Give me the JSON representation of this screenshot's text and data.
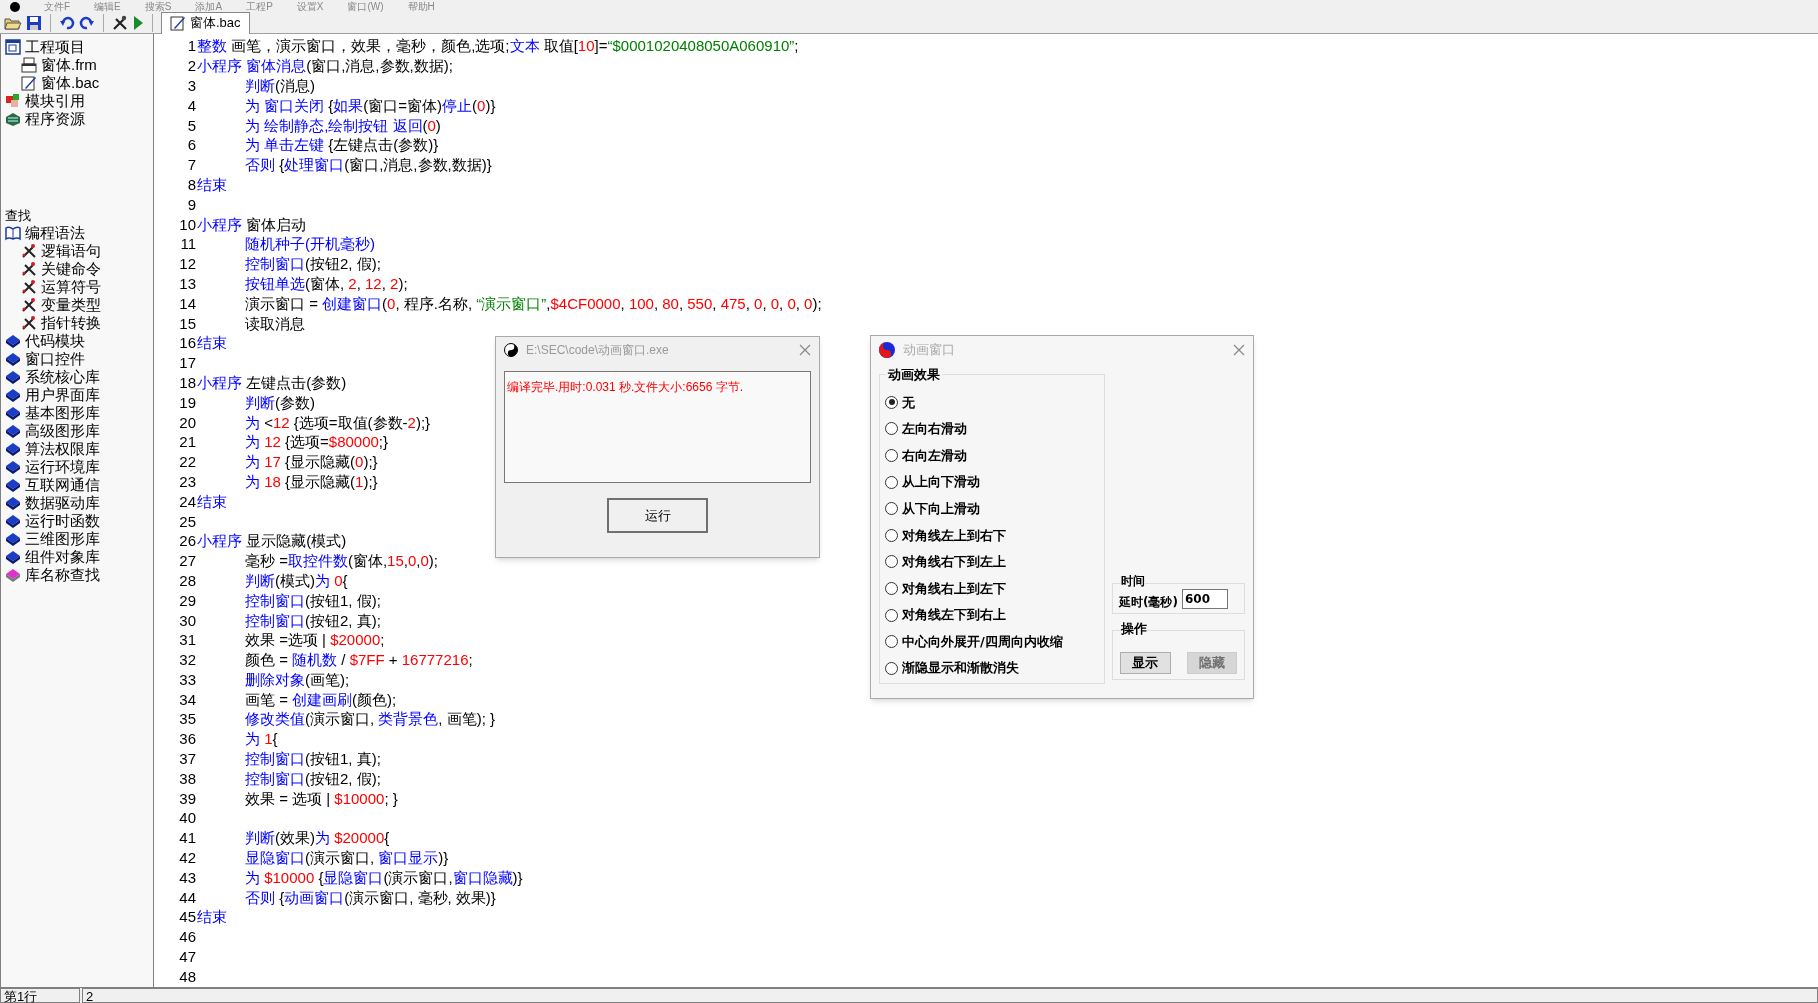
{
  "menu": [
    "文件F",
    "编辑E",
    "搜索S",
    "添加A",
    "工程P",
    "设置X",
    "窗口(W)",
    "帮助H"
  ],
  "toolbar": {
    "tab": {
      "label": "窗体.bac",
      "selected": true
    }
  },
  "sidebar": {
    "project": [
      {
        "label": "工程项目",
        "kind": "project",
        "children": [
          {
            "label": "窗体.frm",
            "kind": "form"
          },
          {
            "label": "窗体.bac",
            "kind": "code"
          }
        ]
      },
      {
        "label": "模块引用",
        "kind": "module"
      },
      {
        "label": "程序资源",
        "kind": "resource"
      }
    ],
    "search_label": "查找",
    "library": [
      {
        "label": "编程语法",
        "kind": "syntax",
        "children": [
          {
            "label": "逻辑语句",
            "kind": "tool"
          },
          {
            "label": "关键命令",
            "kind": "tool"
          },
          {
            "label": "运算符号",
            "kind": "tool"
          },
          {
            "label": "变量类型",
            "kind": "tool"
          },
          {
            "label": "指针转换",
            "kind": "tool"
          }
        ]
      },
      {
        "label": "代码模块",
        "kind": "book"
      },
      {
        "label": "窗口控件",
        "kind": "book"
      },
      {
        "label": "系统核心库",
        "kind": "book"
      },
      {
        "label": "用户界面库",
        "kind": "book"
      },
      {
        "label": "基本图形库",
        "kind": "book"
      },
      {
        "label": "高级图形库",
        "kind": "book"
      },
      {
        "label": "算法权限库",
        "kind": "book"
      },
      {
        "label": "运行环境库",
        "kind": "book"
      },
      {
        "label": "互联网通信",
        "kind": "book"
      },
      {
        "label": "数据驱动库",
        "kind": "book"
      },
      {
        "label": "运行时函数",
        "kind": "book"
      },
      {
        "label": "三维图形库",
        "kind": "book"
      },
      {
        "label": "组件对象库",
        "kind": "book"
      },
      {
        "label": "库名称查找",
        "kind": "search-book"
      }
    ]
  },
  "editor": {
    "lines": [
      {
        "number": "1",
        "indented": false,
        "segments": [
          {
            "kind": "kw",
            "text": "整数"
          },
          {
            "kind": "p",
            "text": " 画笔，演示窗口，效果，毫秒，颜色,选项;"
          },
          {
            "kind": "kw",
            "text": "文本"
          },
          {
            "kind": "p",
            "text": " 取值["
          },
          {
            "kind": "num",
            "text": "10"
          },
          {
            "kind": "p",
            "text": "]="
          },
          {
            "kind": "str",
            "text": "“$0001020408050A060910”"
          },
          {
            "kind": "p",
            "text": ";"
          }
        ]
      },
      {
        "number": "2",
        "indented": false,
        "segments": [
          {
            "kind": "kw",
            "text": "小程序 窗体消息"
          },
          {
            "kind": "p",
            "text": "(窗口,消息,参数,数据);"
          }
        ]
      },
      {
        "number": "3",
        "indented": true,
        "segments": [
          {
            "kind": "kw",
            "text": "判断"
          },
          {
            "kind": "p",
            "text": "(消息)"
          }
        ]
      },
      {
        "number": "4",
        "indented": true,
        "segments": [
          {
            "kind": "kw",
            "text": "为 窗口关闭"
          },
          {
            "kind": "p",
            "text": " {"
          },
          {
            "kind": "kw",
            "text": "如果"
          },
          {
            "kind": "p",
            "text": "(窗口=窗体)"
          },
          {
            "kind": "kw",
            "text": "停止"
          },
          {
            "kind": "p",
            "text": "("
          },
          {
            "kind": "num",
            "text": "0"
          },
          {
            "kind": "p",
            "text": ")}"
          }
        ]
      },
      {
        "number": "5",
        "indented": true,
        "segments": [
          {
            "kind": "kw",
            "text": "为 绘制静态,绘制按钮 返回"
          },
          {
            "kind": "p",
            "text": "("
          },
          {
            "kind": "num",
            "text": "0"
          },
          {
            "kind": "p",
            "text": ")"
          }
        ]
      },
      {
        "number": "6",
        "indented": true,
        "segments": [
          {
            "kind": "kw",
            "text": "为 单击左键"
          },
          {
            "kind": "p",
            "text": " {左键点击(参数)}"
          }
        ]
      },
      {
        "number": "7",
        "indented": true,
        "segments": [
          {
            "kind": "kw",
            "text": "否则"
          },
          {
            "kind": "p",
            "text": " {"
          },
          {
            "kind": "kw",
            "text": "处理窗口"
          },
          {
            "kind": "p",
            "text": "(窗口,消息,参数,数据)}"
          }
        ]
      },
      {
        "number": "8",
        "indented": false,
        "segments": [
          {
            "kind": "kw",
            "text": "结束"
          }
        ]
      },
      {
        "number": "9"
      },
      {
        "number": "10",
        "indented": false,
        "segments": [
          {
            "kind": "kw",
            "text": "小程序"
          },
          {
            "kind": "p",
            "text": " 窗体启动"
          }
        ]
      },
      {
        "number": "11",
        "indented": true,
        "segments": [
          {
            "kind": "kw",
            "text": "随机种子(开机毫秒)"
          }
        ]
      },
      {
        "number": "12",
        "indented": true,
        "segments": [
          {
            "kind": "kw",
            "text": "控制窗口"
          },
          {
            "kind": "p",
            "text": "(按钮2, 假);"
          }
        ]
      },
      {
        "number": "13",
        "indented": true,
        "segments": [
          {
            "kind": "kw",
            "text": "按钮单选"
          },
          {
            "kind": "p",
            "text": "(窗体, "
          },
          {
            "kind": "num",
            "text": "2"
          },
          {
            "kind": "p",
            "text": ", "
          },
          {
            "kind": "num",
            "text": "12"
          },
          {
            "kind": "p",
            "text": ", "
          },
          {
            "kind": "num",
            "text": "2"
          },
          {
            "kind": "p",
            "text": ");"
          }
        ]
      },
      {
        "number": "14",
        "indented": true,
        "segments": [
          {
            "kind": "p",
            "text": "演示窗口 = "
          },
          {
            "kind": "kw",
            "text": "创建窗口"
          },
          {
            "kind": "p",
            "text": "("
          },
          {
            "kind": "num",
            "text": "0"
          },
          {
            "kind": "p",
            "text": ", 程序.名称, "
          },
          {
            "kind": "str",
            "text": "“演示窗口”"
          },
          {
            "kind": "p",
            "text": ","
          },
          {
            "kind": "num",
            "text": "$4CF0000"
          },
          {
            "kind": "p",
            "text": ", "
          },
          {
            "kind": "num",
            "text": "100"
          },
          {
            "kind": "p",
            "text": ", "
          },
          {
            "kind": "num",
            "text": "80"
          },
          {
            "kind": "p",
            "text": ", "
          },
          {
            "kind": "num",
            "text": "550"
          },
          {
            "kind": "p",
            "text": ", "
          },
          {
            "kind": "num",
            "text": "475"
          },
          {
            "kind": "p",
            "text": ", "
          },
          {
            "kind": "num",
            "text": "0"
          },
          {
            "kind": "p",
            "text": ", "
          },
          {
            "kind": "num",
            "text": "0"
          },
          {
            "kind": "p",
            "text": ", "
          },
          {
            "kind": "num",
            "text": "0"
          },
          {
            "kind": "p",
            "text": ", "
          },
          {
            "kind": "num",
            "text": "0"
          },
          {
            "kind": "p",
            "text": ");"
          }
        ]
      },
      {
        "number": "15",
        "indented": true,
        "segments": [
          {
            "kind": "p",
            "text": "读取消息"
          }
        ]
      },
      {
        "number": "16",
        "indented": false,
        "segments": [
          {
            "kind": "kw",
            "text": "结束"
          }
        ]
      },
      {
        "number": "17"
      },
      {
        "number": "18",
        "indented": false,
        "segments": [
          {
            "kind": "kw",
            "text": "小程序"
          },
          {
            "kind": "p",
            "text": " 左键点击(参数)"
          }
        ]
      },
      {
        "number": "19",
        "indented": true,
        "segments": [
          {
            "kind": "kw",
            "text": "判断"
          },
          {
            "kind": "p",
            "text": "(参数)"
          }
        ]
      },
      {
        "number": "20",
        "indented": true,
        "segments": [
          {
            "kind": "kw",
            "text": "为"
          },
          {
            "kind": "p",
            "text": " <"
          },
          {
            "kind": "num",
            "text": "12"
          },
          {
            "kind": "p",
            "text": " {选项=取值(参数-"
          },
          {
            "kind": "num",
            "text": "2"
          },
          {
            "kind": "p",
            "text": ");}"
          }
        ]
      },
      {
        "number": "21",
        "indented": true,
        "segments": [
          {
            "kind": "kw",
            "text": "为 "
          },
          {
            "kind": "num",
            "text": "12"
          },
          {
            "kind": "p",
            "text": " {选项="
          },
          {
            "kind": "num",
            "text": "$80000"
          },
          {
            "kind": "p",
            "text": ";}"
          }
        ]
      },
      {
        "number": "22",
        "indented": true,
        "segments": [
          {
            "kind": "kw",
            "text": "为 "
          },
          {
            "kind": "num",
            "text": "17"
          },
          {
            "kind": "p",
            "text": " {显示隐藏("
          },
          {
            "kind": "num",
            "text": "0"
          },
          {
            "kind": "p",
            "text": ");}"
          }
        ]
      },
      {
        "number": "23",
        "indented": true,
        "segments": [
          {
            "kind": "kw",
            "text": "为 "
          },
          {
            "kind": "num",
            "text": "18"
          },
          {
            "kind": "p",
            "text": " {显示隐藏("
          },
          {
            "kind": "num",
            "text": "1"
          },
          {
            "kind": "p",
            "text": ");}"
          }
        ]
      },
      {
        "number": "24",
        "indented": false,
        "segments": [
          {
            "kind": "kw",
            "text": "结束"
          }
        ]
      },
      {
        "number": "25"
      },
      {
        "number": "26",
        "indented": false,
        "segments": [
          {
            "kind": "kw",
            "text": "小程序"
          },
          {
            "kind": "p",
            "text": " 显示隐藏(模式)"
          }
        ]
      },
      {
        "number": "27",
        "indented": true,
        "segments": [
          {
            "kind": "p",
            "text": "毫秒 ="
          },
          {
            "kind": "kw",
            "text": "取控件数"
          },
          {
            "kind": "p",
            "text": "(窗体,"
          },
          {
            "kind": "num",
            "text": "15"
          },
          {
            "kind": "p",
            "text": ","
          },
          {
            "kind": "num",
            "text": "0"
          },
          {
            "kind": "p",
            "text": ","
          },
          {
            "kind": "num",
            "text": "0"
          },
          {
            "kind": "p",
            "text": ");"
          }
        ]
      },
      {
        "number": "28",
        "indented": true,
        "segments": [
          {
            "kind": "kw",
            "text": "判断"
          },
          {
            "kind": "p",
            "text": "(模式)"
          },
          {
            "kind": "kw",
            "text": "为 "
          },
          {
            "kind": "num",
            "text": "0"
          },
          {
            "kind": "p",
            "text": "{"
          }
        ]
      },
      {
        "number": "29",
        "indented": true,
        "segments": [
          {
            "kind": "kw",
            "text": "控制窗口"
          },
          {
            "kind": "p",
            "text": "(按钮1, 假);"
          }
        ]
      },
      {
        "number": "30",
        "indented": true,
        "segments": [
          {
            "kind": "kw",
            "text": "控制窗口"
          },
          {
            "kind": "p",
            "text": "(按钮2, 真);"
          }
        ]
      },
      {
        "number": "31",
        "indented": true,
        "segments": [
          {
            "kind": "p",
            "text": "效果 =选项 | "
          },
          {
            "kind": "num",
            "text": "$20000"
          },
          {
            "kind": "p",
            "text": ";"
          }
        ]
      },
      {
        "number": "32",
        "indented": true,
        "segments": [
          {
            "kind": "p",
            "text": "颜色 = "
          },
          {
            "kind": "kw",
            "text": "随机数"
          },
          {
            "kind": "p",
            "text": " / "
          },
          {
            "kind": "num",
            "text": "$7FF"
          },
          {
            "kind": "p",
            "text": " + "
          },
          {
            "kind": "num",
            "text": "16777216"
          },
          {
            "kind": "p",
            "text": ";"
          }
        ]
      },
      {
        "number": "33",
        "indented": true,
        "segments": [
          {
            "kind": "kw",
            "text": "删除对象"
          },
          {
            "kind": "p",
            "text": "(画笔);"
          }
        ]
      },
      {
        "number": "34",
        "indented": true,
        "segments": [
          {
            "kind": "p",
            "text": "画笔 = "
          },
          {
            "kind": "kw",
            "text": "创建画刷"
          },
          {
            "kind": "p",
            "text": "(颜色);"
          }
        ]
      },
      {
        "number": "35",
        "indented": true,
        "segments": [
          {
            "kind": "kw",
            "text": "修改类值"
          },
          {
            "kind": "p",
            "text": "(演示窗口, "
          },
          {
            "kind": "kw",
            "text": "类背景色"
          },
          {
            "kind": "p",
            "text": ", 画笔); }"
          }
        ]
      },
      {
        "number": "36",
        "indented": true,
        "segments": [
          {
            "kind": "kw",
            "text": "为 "
          },
          {
            "kind": "num",
            "text": "1"
          },
          {
            "kind": "p",
            "text": "{"
          }
        ]
      },
      {
        "number": "37",
        "indented": true,
        "segments": [
          {
            "kind": "kw",
            "text": "控制窗口"
          },
          {
            "kind": "p",
            "text": "(按钮1, 真);"
          }
        ]
      },
      {
        "number": "38",
        "indented": true,
        "segments": [
          {
            "kind": "kw",
            "text": "控制窗口"
          },
          {
            "kind": "p",
            "text": "(按钮2, 假);"
          }
        ]
      },
      {
        "number": "39",
        "indented": true,
        "segments": [
          {
            "kind": "p",
            "text": "效果 = 选项 | "
          },
          {
            "kind": "num",
            "text": "$10000"
          },
          {
            "kind": "p",
            "text": "; }"
          }
        ]
      },
      {
        "number": "40"
      },
      {
        "number": "41",
        "indented": true,
        "segments": [
          {
            "kind": "kw",
            "text": "判断"
          },
          {
            "kind": "p",
            "text": "(效果)"
          },
          {
            "kind": "kw",
            "text": "为 "
          },
          {
            "kind": "num",
            "text": "$20000"
          },
          {
            "kind": "p",
            "text": "{"
          }
        ]
      },
      {
        "number": "42",
        "indented": true,
        "segments": [
          {
            "kind": "kw",
            "text": "显隐窗口"
          },
          {
            "kind": "p",
            "text": "(演示窗口, "
          },
          {
            "kind": "kw",
            "text": "窗口显示"
          },
          {
            "kind": "p",
            "text": ")}"
          }
        ]
      },
      {
        "number": "43",
        "indented": true,
        "segments": [
          {
            "kind": "kw",
            "text": "为 "
          },
          {
            "kind": "num",
            "text": "$10000"
          },
          {
            "kind": "p",
            "text": " {"
          },
          {
            "kind": "kw",
            "text": "显隐窗口"
          },
          {
            "kind": "p",
            "text": "(演示窗口,"
          },
          {
            "kind": "kw",
            "text": "窗口隐藏"
          },
          {
            "kind": "p",
            "text": ")}"
          }
        ]
      },
      {
        "number": "44",
        "indented": true,
        "segments": [
          {
            "kind": "kw",
            "text": "否则"
          },
          {
            "kind": "p",
            "text": " {"
          },
          {
            "kind": "kw",
            "text": "动画窗口"
          },
          {
            "kind": "p",
            "text": "(演示窗口, 毫秒, 效果)}"
          }
        ]
      },
      {
        "number": "45",
        "indented": false,
        "segments": [
          {
            "kind": "kw",
            "text": "结束"
          }
        ]
      },
      {
        "number": "46"
      },
      {
        "number": "47"
      },
      {
        "number": "48"
      }
    ]
  },
  "compile_window": {
    "title": "E:\\SEC\\code\\动画窗口.exe",
    "message": "编译完毕.用时:0.031 秒.文件大小:6656 字节.",
    "button": "运行"
  },
  "animation_window": {
    "title": "动画窗口",
    "effects_title": "动画效果",
    "effects": [
      {
        "label": "无",
        "selected": true
      },
      {
        "label": "左向右滑动",
        "selected": false
      },
      {
        "label": "右向左滑动",
        "selected": false
      },
      {
        "label": "从上向下滑动",
        "selected": false
      },
      {
        "label": "从下向上滑动",
        "selected": false
      },
      {
        "label": "对角线左上到右下",
        "selected": false
      },
      {
        "label": "对角线右下到左上",
        "selected": false
      },
      {
        "label": "对角线右上到左下",
        "selected": false
      },
      {
        "label": "对角线左下到右上",
        "selected": false
      },
      {
        "label": "中心向外展开/四周向内收缩",
        "selected": false
      },
      {
        "label": "渐隐显示和渐散消失",
        "selected": false
      }
    ],
    "time_title": "时间",
    "delay_label": "延时(毫秒)",
    "delay_value": "600",
    "actions_title": "操作",
    "buttons": [
      {
        "label": "显示",
        "disabled": false
      },
      {
        "label": "隐藏",
        "disabled": true
      }
    ]
  },
  "status_bar": {
    "line": "第1行",
    "column_2": "2"
  }
}
